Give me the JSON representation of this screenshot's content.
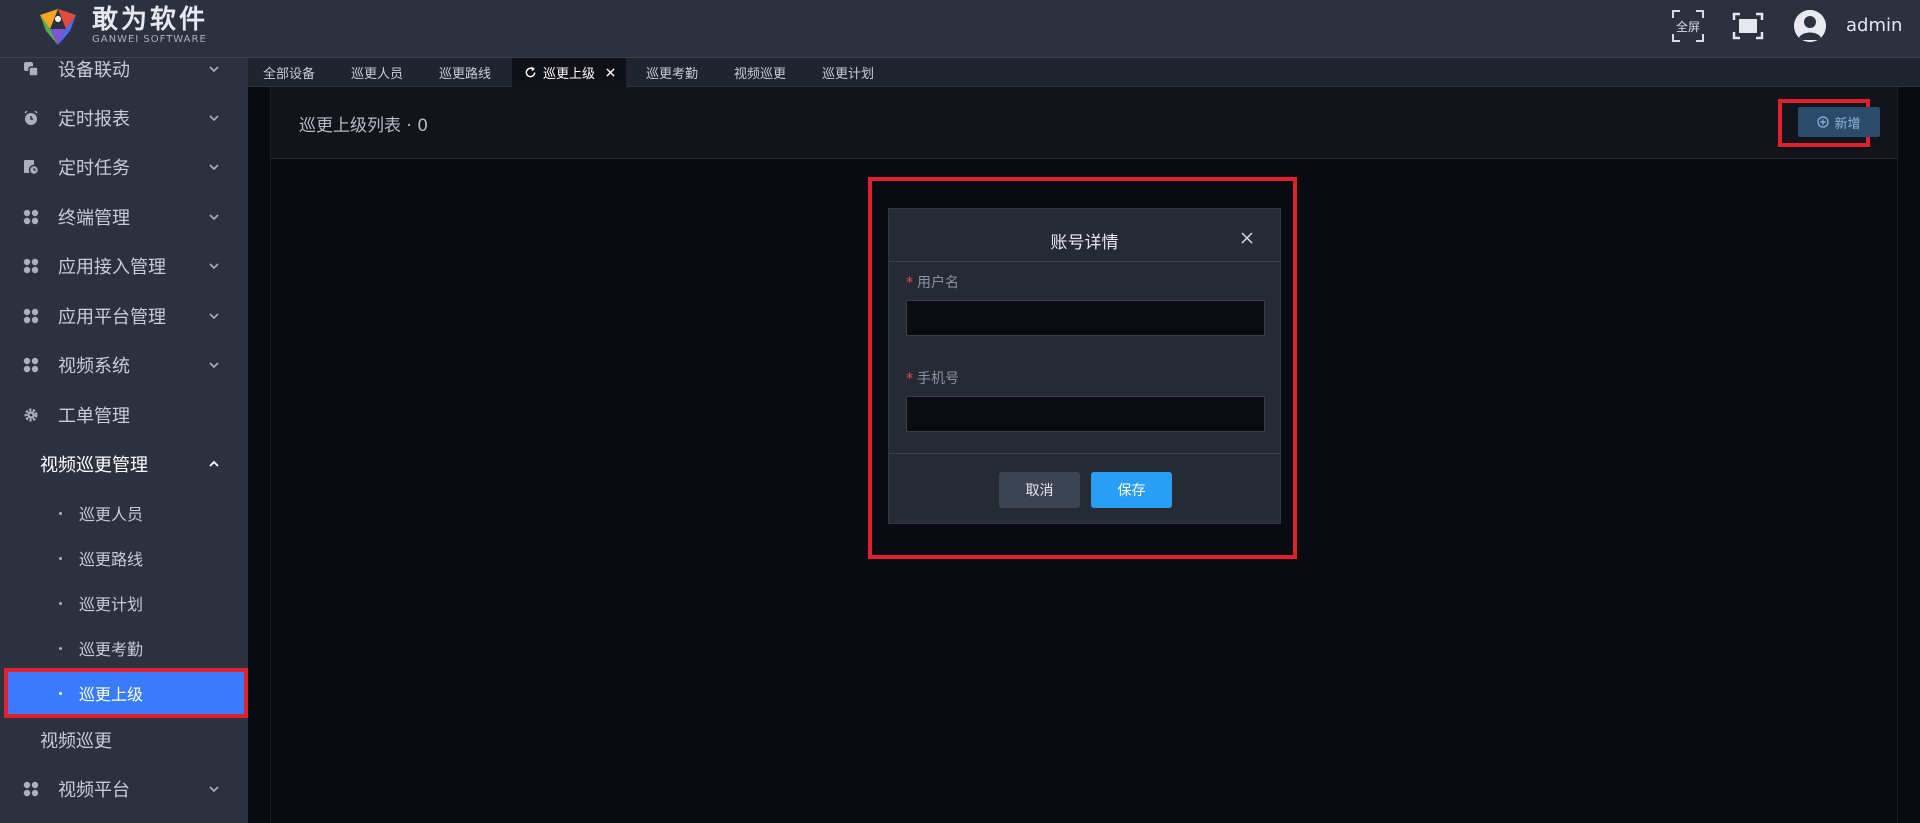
{
  "header": {
    "brand_name": "敢为软件",
    "brand_sub": "GANWEI SOFTWARE",
    "fullscreen_label": "全屏",
    "username": "admin"
  },
  "sidebar": {
    "items": [
      {
        "label": "设备联动",
        "icon": "link-devices-icon"
      },
      {
        "label": "定时报表",
        "icon": "alarm-clock-icon"
      },
      {
        "label": "定时任务",
        "icon": "task-clock-icon"
      },
      {
        "label": "终端管理",
        "icon": "grid-icon"
      },
      {
        "label": "应用接入管理",
        "icon": "grid-icon"
      },
      {
        "label": "应用平台管理",
        "icon": "grid-icon"
      },
      {
        "label": "视频系统",
        "icon": "grid-icon"
      },
      {
        "label": "工单管理",
        "icon": "gear-icon"
      }
    ],
    "group_open": "视频巡更管理",
    "sub_items": [
      "巡更人员",
      "巡更路线",
      "巡更计划",
      "巡更考勤",
      "巡更上级"
    ],
    "active_sub": "巡更上级",
    "after_items": [
      {
        "label": "视频巡更"
      },
      {
        "label": "视频平台",
        "icon": "grid-icon"
      }
    ]
  },
  "tabs": [
    "全部设备",
    "巡更人员",
    "巡更路线",
    "巡更上级",
    "巡更考勤",
    "视频巡更",
    "巡更计划"
  ],
  "active_tab": "巡更上级",
  "content": {
    "list_title": "巡更上级列表 · 0",
    "add_button": "新增"
  },
  "dialog": {
    "title": "账号详情",
    "fields": [
      {
        "label": "用户名",
        "required": true,
        "value": ""
      },
      {
        "label": "手机号",
        "required": true,
        "value": ""
      }
    ],
    "cancel": "取消",
    "save": "保存"
  },
  "colors": {
    "header_bg": "#2c3140",
    "active_item": "#3a7bfd",
    "highlight_outline": "#e0202a",
    "primary_button": "#2a9df4",
    "required_mark": "#f24a4a"
  }
}
